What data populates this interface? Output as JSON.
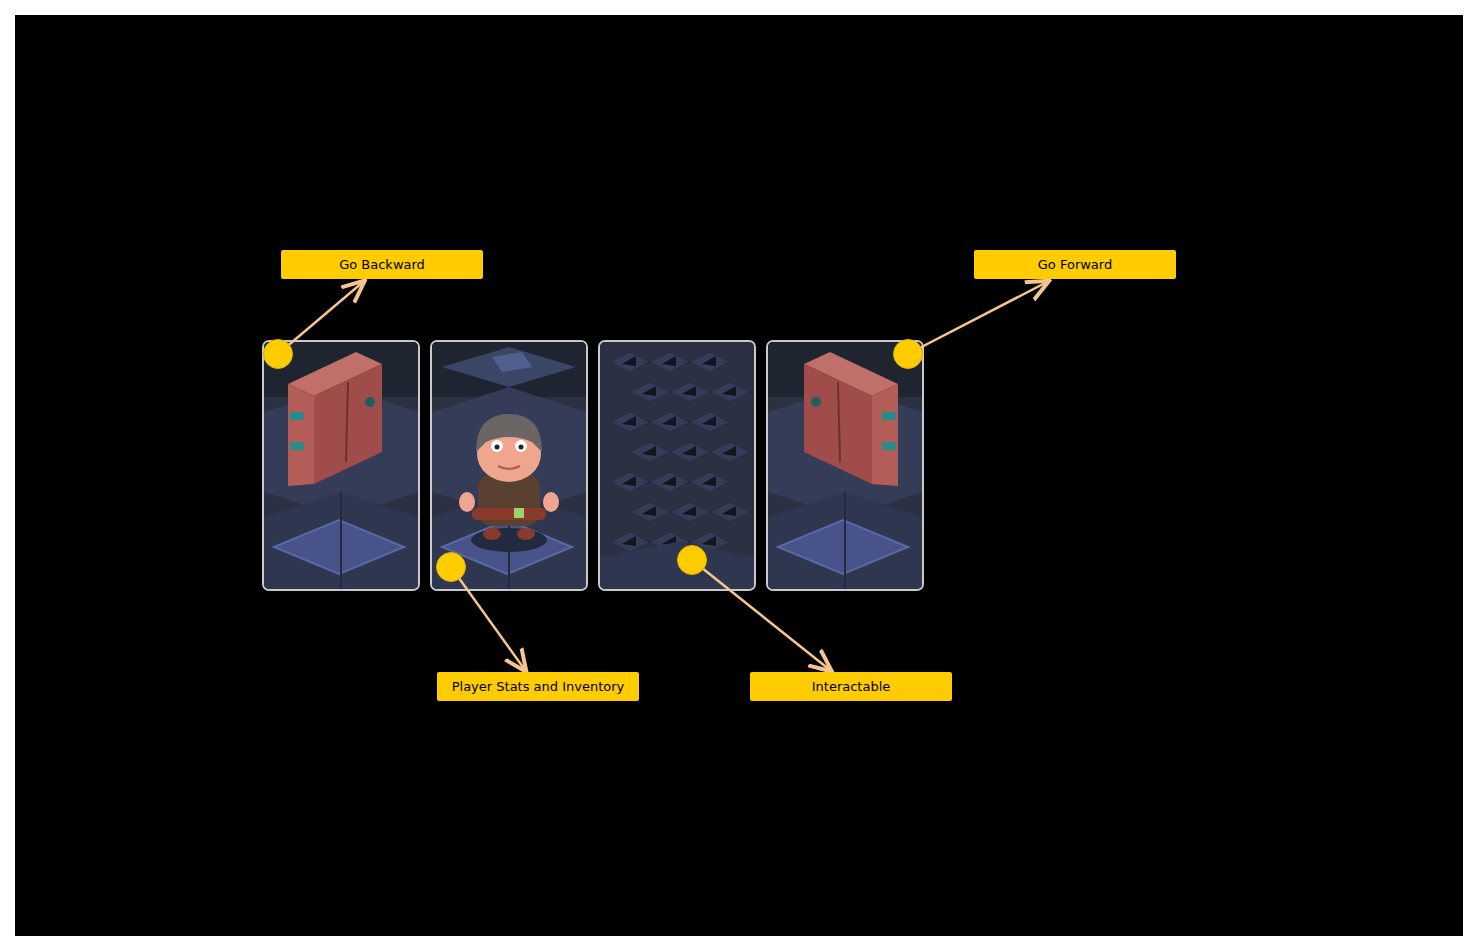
{
  "cards": [
    {
      "kind": "door"
    },
    {
      "kind": "player"
    },
    {
      "kind": "spikes"
    },
    {
      "kind": "door"
    }
  ],
  "annotations": [
    {
      "label": "Go Backward"
    },
    {
      "label": "Go Forward"
    },
    {
      "label": "Player Stats and Inventory"
    },
    {
      "label": "Interactable"
    }
  ]
}
